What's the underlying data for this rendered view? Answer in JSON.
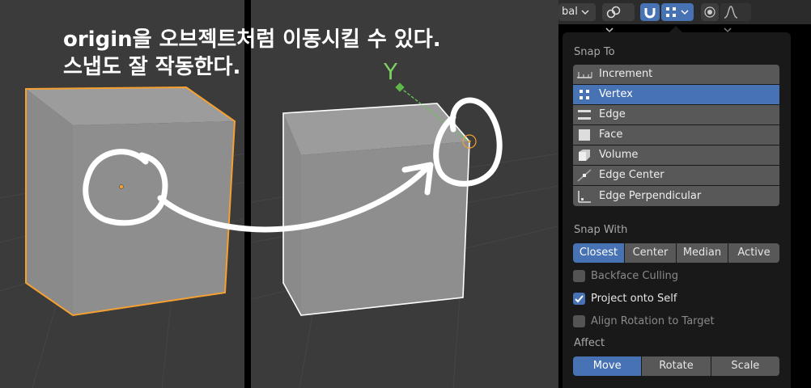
{
  "caption": {
    "line1": "origin을 오브젝트처럼 이동시킬 수 있다.",
    "line2": "스냅도 잘 작동한다."
  },
  "viewport": {
    "axis_label": "Y",
    "colors": {
      "background": "#3b3b3b",
      "cube_face": "#8c8c8c",
      "cube_top": "#9a9a9a",
      "selected_outline": "#f5a030",
      "active_outline": "#ffffff",
      "axis_green": "#6fc25a"
    }
  },
  "header": {
    "dropdown_text": "bal",
    "icons": [
      "chevron-down-icon",
      "link-icon",
      "magnet-icon",
      "vertex-snap-icon",
      "proportional-edit-icon",
      "falloff-curve-icon"
    ]
  },
  "panel": {
    "snap_to_label": "Snap To",
    "snap_to_items": [
      {
        "label": "Increment",
        "icon": "increment-icon",
        "selected": false
      },
      {
        "label": "Vertex",
        "icon": "vertex-icon",
        "selected": true
      },
      {
        "label": "Edge",
        "icon": "edge-icon",
        "selected": false
      },
      {
        "label": "Face",
        "icon": "face-icon",
        "selected": false
      },
      {
        "label": "Volume",
        "icon": "volume-icon",
        "selected": false
      },
      {
        "label": "Edge Center",
        "icon": "edge-center-icon",
        "selected": false
      },
      {
        "label": "Edge Perpendicular",
        "icon": "edge-perpendicular-icon",
        "selected": false
      }
    ],
    "snap_with_label": "Snap With",
    "snap_with_options": [
      "Closest",
      "Center",
      "Median",
      "Active"
    ],
    "snap_with_selected": "Closest",
    "checkboxes": [
      {
        "label": "Backface Culling",
        "checked": false
      },
      {
        "label": "Project onto Self",
        "checked": true
      },
      {
        "label": "Align Rotation to Target",
        "checked": false
      }
    ],
    "affect_label": "Affect",
    "affect_options": [
      "Move",
      "Rotate",
      "Scale"
    ],
    "affect_selected": "Move",
    "accent_color": "#4772b3"
  }
}
